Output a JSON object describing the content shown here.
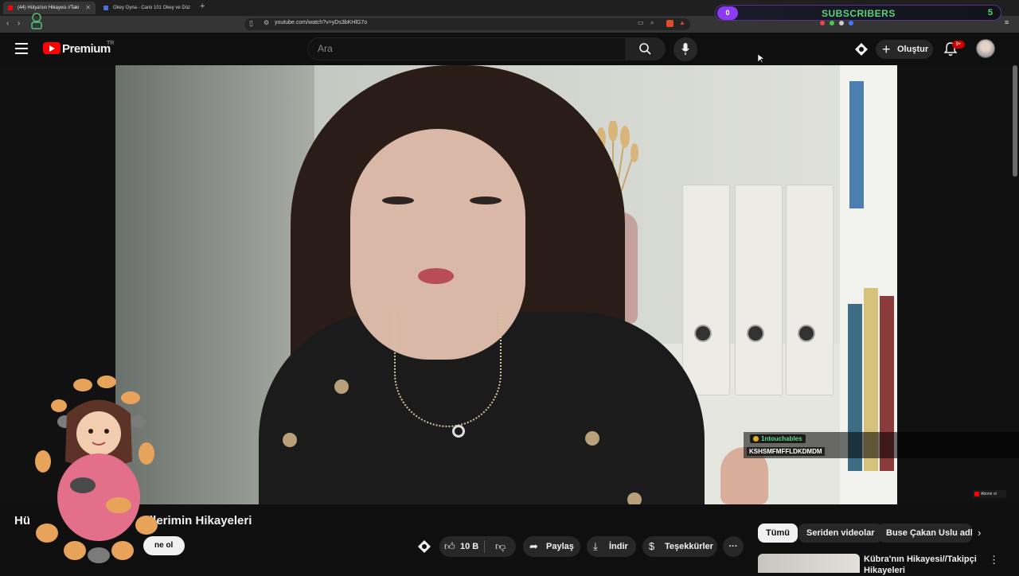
{
  "browser": {
    "tabs": [
      {
        "title": "(44) Hülya'nın Hikayesi //Taki",
        "active": true
      },
      {
        "title": "Okey Oyna - Canlı 101 Okey ve Düz",
        "active": false
      }
    ],
    "url": "youtube.com/watch?v=yDs3bKHlG7o"
  },
  "overlay": {
    "left_count": "0",
    "label": "SUBSCRIBERS",
    "right_count": "5"
  },
  "header": {
    "logo_text": "Premium",
    "country": "TR",
    "search_placeholder": "Ara",
    "create_label": "Oluştur",
    "notification_count": "9+"
  },
  "player": {
    "chat": {
      "user": "1ntouchables",
      "message": "KSHSMFMFFLDKDMDM"
    },
    "corner_label": "Abone ol"
  },
  "video": {
    "title": "Hülya'nın Hikayesi // Takipçilerimin Hikayeleri",
    "title_visible_start": "Hü",
    "title_visible_end": "ilerimin Hikayeleri",
    "subscribe_label": "ne ol",
    "like_count": "10 B",
    "share_label": "Paylaş",
    "download_label": "İndir",
    "thanks_label": "Teşekkürler",
    "more_label": "···"
  },
  "chips": [
    {
      "label": "Tümü",
      "active": true
    },
    {
      "label": "Seriden videolar",
      "active": false
    },
    {
      "label": "Buse Çakan Uslu adlı",
      "active": false
    }
  ],
  "recommendation": {
    "title": "Kübra'nın Hikayesi//Takipçi Hikayeleri"
  },
  "colors": {
    "accent": "#ff0000",
    "overlay_green": "#5ad37e",
    "overlay_purple": "#8b3cf0",
    "background": "#0f0f0f"
  }
}
